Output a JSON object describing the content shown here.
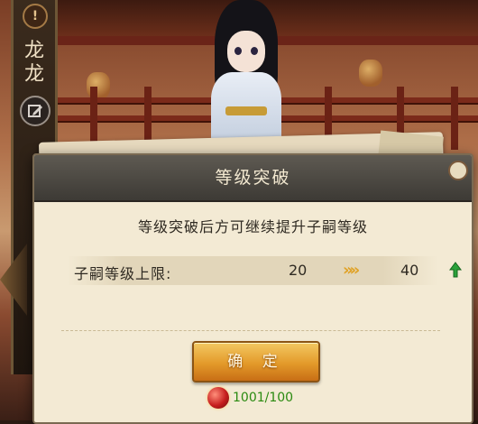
{
  "side_panel": {
    "warning_icon_char": "!",
    "name_chars": [
      "龙",
      "龙"
    ]
  },
  "dialog": {
    "title": "等级突破",
    "message": "等级突破后方可继续提升子嗣等级",
    "level_row": {
      "label": "子嗣等级上限:",
      "from": "20",
      "arrows": "»»",
      "to": "40"
    },
    "confirm_label": "确 定",
    "cost": "1001/100"
  },
  "colors": {
    "accent": "#e39a2a",
    "cost_text": "#2a8a10",
    "up_arrow": "#2aa13a"
  }
}
